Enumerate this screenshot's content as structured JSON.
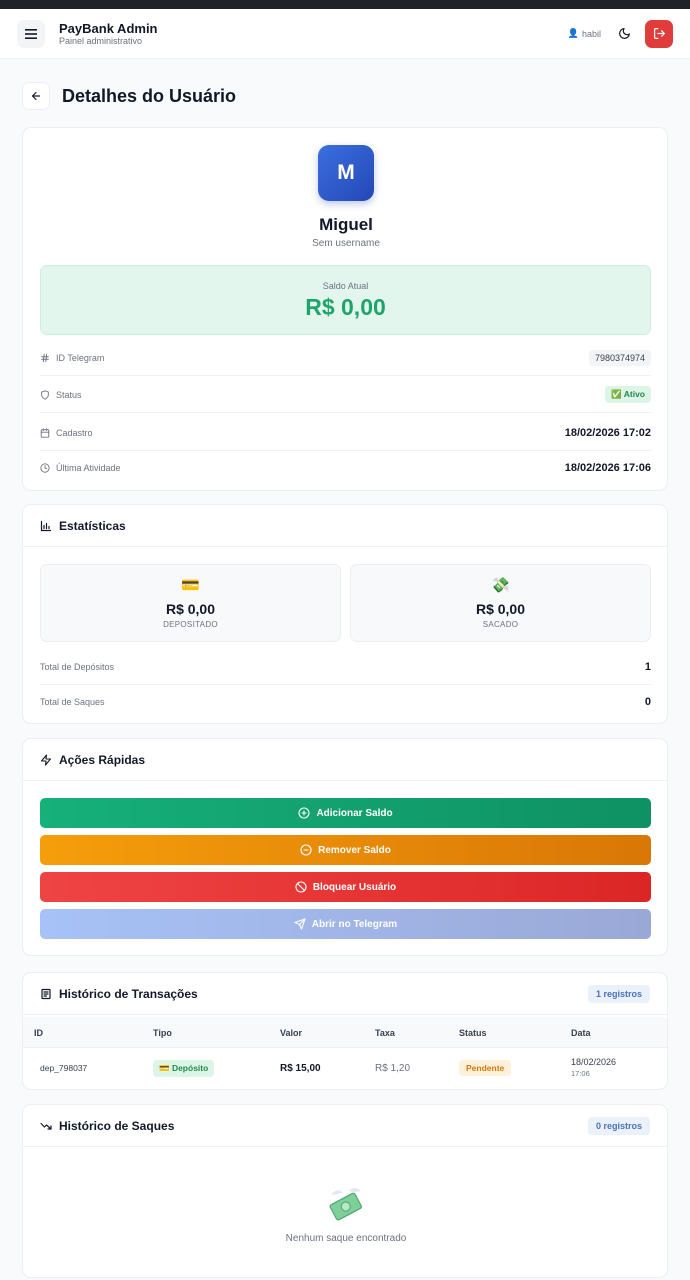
{
  "header": {
    "title": "PayBank Admin",
    "subtitle": "Painel administrativo",
    "user": "habil"
  },
  "page": {
    "title": "Detalhes do Usuário"
  },
  "profile": {
    "initial": "M",
    "name": "Miguel",
    "username": "Sem username",
    "balance_label": "Saldo Atual",
    "balance_value": "R$ 0,00",
    "rows": [
      {
        "label": "ID Telegram",
        "value": "7980374974"
      },
      {
        "label": "Status",
        "value": "✅ Ativo"
      },
      {
        "label": "Cadastro",
        "value": "18/02/2026 17:02"
      },
      {
        "label": "Última Atividade",
        "value": "18/02/2026 17:06"
      }
    ]
  },
  "stats": {
    "title": "Estatísticas",
    "deposited": {
      "emoji": "💳",
      "value": "R$ 0,00",
      "label": "DEPOSITADO"
    },
    "withdrawn": {
      "emoji": "💸",
      "value": "R$ 0,00",
      "label": "SACADO"
    },
    "rows": [
      {
        "label": "Total de Depósitos",
        "value": "1"
      },
      {
        "label": "Total de Saques",
        "value": "0"
      }
    ]
  },
  "actions": {
    "title": "Ações Rápidas",
    "add": "Adicionar Saldo",
    "remove": "Remover Saldo",
    "block": "Bloquear Usuário",
    "telegram": "Abrir no Telegram"
  },
  "transactions": {
    "title": "Histórico de Transações",
    "count": "1 registros",
    "columns": [
      "ID",
      "Tipo",
      "Valor",
      "Taxa",
      "Status",
      "Data"
    ],
    "rows": [
      {
        "id": "dep_798037",
        "type": "💳 Depósito",
        "value": "R$ 15,00",
        "fee": "R$ 1,20",
        "status": "Pendente",
        "date": "18/02/2026",
        "time": "17:06"
      }
    ]
  },
  "withdrawals": {
    "title": "Histórico de Saques",
    "count": "0 registros",
    "empty": "Nenhum saque encontrado"
  },
  "colors": {
    "accent_green": "#1fa46a",
    "danger_red": "#e03c3c",
    "avatar_blue": "#2f5fd0"
  }
}
